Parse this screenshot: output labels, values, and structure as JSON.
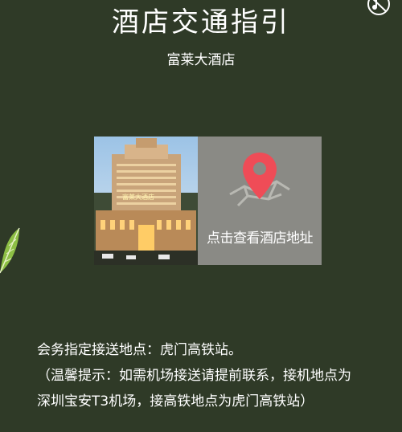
{
  "page": {
    "title": "酒店交通指引",
    "subtitle": "富莱大酒店"
  },
  "card": {
    "map_label": "点击查看酒店地址",
    "photo_sign": "富莱大酒店"
  },
  "info": {
    "meeting_point": "会务指定接送地点：虎门高铁站。",
    "note_line1": "（温馨提示：如需机场接送请提前联系，接机地点为",
    "note_line2": "深圳宝安T3机场，接高铁地点为虎门高铁站）"
  },
  "colors": {
    "background": "#2f3a27",
    "map_panel": "#8a8a85",
    "pin": "#ef4c57",
    "leaf": "#8dbf45"
  },
  "icons": [
    "music-icon",
    "leaf-decoration-icon",
    "map-pin-icon"
  ]
}
